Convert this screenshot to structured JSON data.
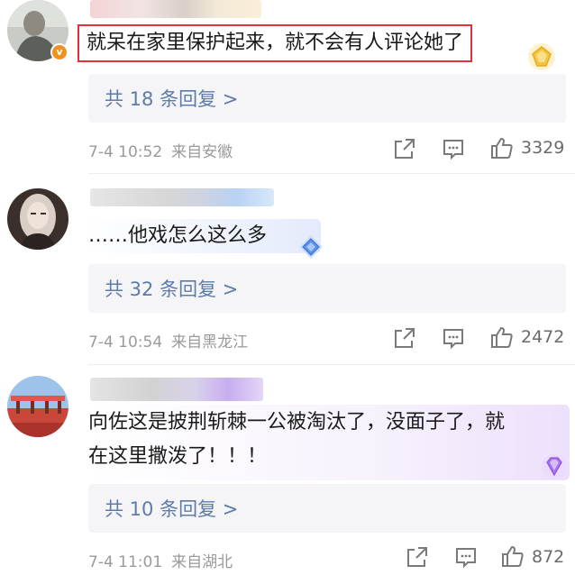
{
  "comments": [
    {
      "text": "就呆在家里保护起来，就不会有人评论她了",
      "reply_label": "共 18 条回复 >",
      "date": "7-4 10:52",
      "location": "来自安徽",
      "likes": "3329",
      "verified_badge": "v",
      "gem_color": "#f7c948"
    },
    {
      "text": "……他戏怎么这么多",
      "reply_label": "共 32 条回复 >",
      "date": "7-4 10:54",
      "location": "来自黑龙江",
      "likes": "2472",
      "gem_color": "#4f8ef0"
    },
    {
      "text_line1": "向佐这是披荆斩棘一公被淘汰了，没面子了，就",
      "text_line2": "在这里撒泼了！！！",
      "reply_label": "共 10 条回复 >",
      "date": "7-4 11:01",
      "location": "来自湖北",
      "likes": "872",
      "gem_color": "#b07ef0"
    }
  ],
  "icons": [
    "share-icon",
    "comment-icon",
    "like-icon"
  ]
}
